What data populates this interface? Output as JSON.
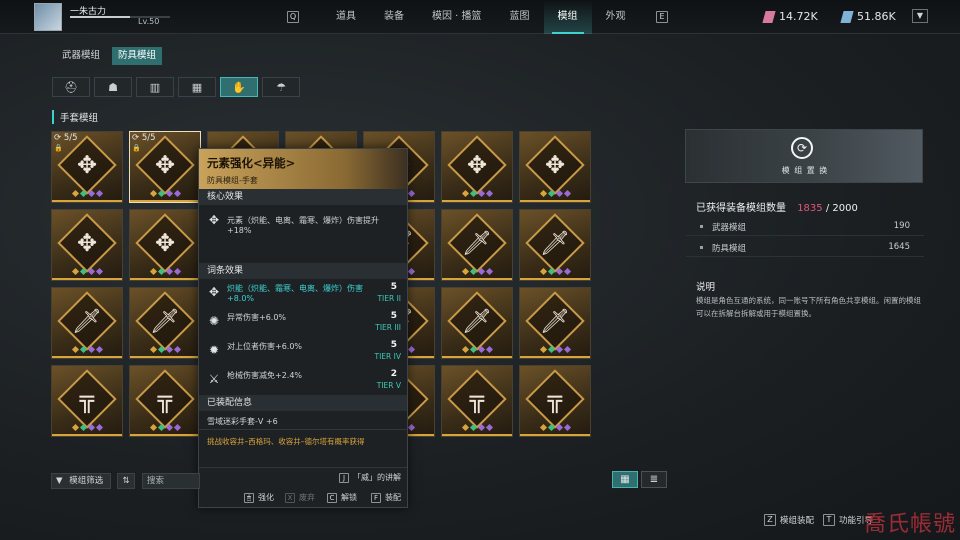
{
  "player": {
    "name": "一朱古力",
    "level": "Lv.50"
  },
  "nav": {
    "key_left": "Q",
    "key_right": "E",
    "items": [
      "道具",
      "装备",
      "模因 · 播篮",
      "蓝图",
      "模组",
      "外观"
    ],
    "active_index": 4
  },
  "currency": [
    {
      "value": "14.72K",
      "color": "#d87a9a",
      "icon": "crystal-pink-icon"
    },
    {
      "value": "51.86K",
      "color": "#7fb3d6",
      "icon": "crystal-blue-icon"
    }
  ],
  "tabs": [
    "武器模组",
    "防具模组"
  ],
  "active_tab": 1,
  "subtabs": [
    "helmet-icon",
    "chest-icon",
    "jacket-icon",
    "pants-icon",
    "glove-icon",
    "boots-icon"
  ],
  "subtab_glyphs": [
    "⛑",
    "☗",
    "▥",
    "▦",
    "✋",
    "☂"
  ],
  "active_subtab": 4,
  "section_title": "手套模组",
  "grid": {
    "count_label": "5/5",
    "rows": [
      [
        "crest",
        "crest",
        "crest",
        "crest",
        "crest",
        "crest",
        "crest"
      ],
      [
        "crest",
        "crest",
        "knife",
        "knife",
        "knife",
        "knife",
        "knife"
      ],
      [
        "knife",
        "knife",
        "knife",
        "knife",
        "knife",
        "knife",
        "knife"
      ],
      [
        "gun",
        "gun",
        "gun",
        "gun",
        "gun",
        "gun",
        "gun"
      ]
    ],
    "glyphs": {
      "crest": "✥",
      "knife": "🗡",
      "gun": "╦"
    },
    "dot_colors": [
      "#d8a43c",
      "#3fbf7f",
      "#9a6ad8",
      "#9a6ad8"
    ]
  },
  "tooltip": {
    "title": "元素强化<异能>",
    "subtitle": "防具模组-手套",
    "core_header": "核心效果",
    "core_text": "元素（炽能、电离、霜寒、爆炸）伤害提升+18%",
    "affix_header": "词条效果",
    "affixes": [
      {
        "text": "炽能（炽能、霜寒、电离、爆炸）伤害+8.0%",
        "value": "5",
        "tier": "TIER II",
        "highlight": true
      },
      {
        "text": "异常伤害+6.0%",
        "value": "5",
        "tier": "TIER III",
        "highlight": false
      },
      {
        "text": "对上位者伤害+6.0%",
        "value": "5",
        "tier": "TIER IV",
        "highlight": false
      },
      {
        "text": "枪械伤害减免+2.4%",
        "value": "2",
        "tier": "TIER V",
        "highlight": false
      }
    ],
    "equipped_header": "已装配信息",
    "equipped_text": "雪域迷彩手套-V +6",
    "source_text": "挑战收容井–西格玛、收容井–德尔塔有概率获得",
    "hint_key": "J",
    "hint_text": "「威」的讲解",
    "actions": [
      {
        "key": "🖱",
        "label": "强化"
      },
      {
        "key": "X",
        "label": "废弃"
      },
      {
        "key": "C",
        "label": "解锁"
      },
      {
        "key": "F",
        "label": "装配"
      }
    ]
  },
  "right_panel": {
    "banner_label": "模 组 置 换",
    "count_title": "已获得装备模组数量",
    "count_value": "1835",
    "count_max": "/ 2000",
    "rows": [
      {
        "label": "武器模组",
        "value": "190"
      },
      {
        "label": "防具模组",
        "value": "1645"
      }
    ],
    "desc_title": "说明",
    "desc_text": "模组是角色互通的系统，同一账号下所有角色共享模组。闲置的模组可以在拆解台拆解或用于模组置换。"
  },
  "bottom": {
    "filter_label": "模组筛选",
    "sort_icon": "⇅",
    "search_placeholder": "搜索",
    "keys": [
      {
        "key": "Z",
        "label": "模组装配"
      },
      {
        "key": "T",
        "label": "功能引导"
      }
    ]
  },
  "watermark": "喬氏帳號"
}
